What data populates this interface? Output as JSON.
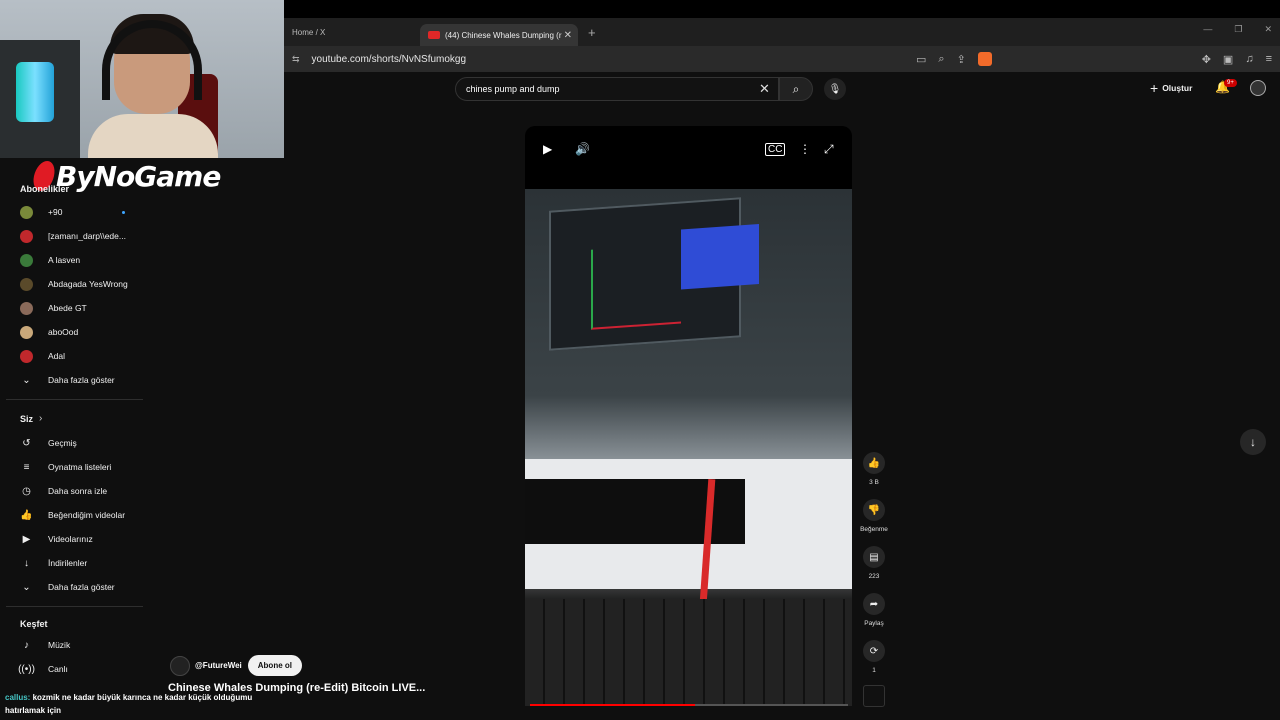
{
  "browser": {
    "tabs": [
      {
        "label": "Home / X"
      },
      {
        "label": "(44) Chinese Whales Dumping (r"
      }
    ],
    "new_tab": "+",
    "url": "youtube.com/shorts/NvNSfumokgg"
  },
  "stream_overlay": {
    "logo_text": "ByNoGame"
  },
  "header": {
    "search_value": "chines pump and dump",
    "create_label": "Oluştur",
    "notification_count": "9+"
  },
  "sidebar": {
    "subscriptions_title": "Abonelikler",
    "subscriptions": [
      {
        "label": "+90",
        "color": "#7a8a3a"
      },
      {
        "label": "[zamanı_darp\\\\ede...",
        "color": "#c0282c"
      },
      {
        "label": "A lasven",
        "color": "#3a7a3a"
      },
      {
        "label": "Abdagada YesWrong",
        "color": "#5a4a2a"
      },
      {
        "label": "Abede GT",
        "color": "#8a6a5a"
      },
      {
        "label": "aboOod",
        "color": "#c9a87a"
      },
      {
        "label": "Adal",
        "color": "#c0282c"
      }
    ],
    "show_more_1": "Daha fazla göster",
    "you_title": "Siz",
    "you_items": [
      {
        "label": "Geçmiş",
        "icon": "history-icon"
      },
      {
        "label": "Oynatma listeleri",
        "icon": "playlist-icon"
      },
      {
        "label": "Daha sonra izle",
        "icon": "clock-icon"
      },
      {
        "label": "Beğendiğim videolar",
        "icon": "like-icon"
      },
      {
        "label": "Videolarınız",
        "icon": "video-icon"
      },
      {
        "label": "İndirilenler",
        "icon": "download-icon"
      }
    ],
    "show_more_2": "Daha fazla göster",
    "explore_title": "Keşfet",
    "explore_items": [
      {
        "label": "Müzik",
        "icon": "music-icon"
      },
      {
        "label": "Canlı",
        "icon": "live-icon"
      }
    ]
  },
  "short": {
    "channel_handle": "@FutureWei",
    "subscribe_label": "Abone ol",
    "title": "Chinese Whales Dumping (re-Edit) Bitcoin LIVE...",
    "progress": 0.52
  },
  "actions": {
    "likes": "3 B",
    "dislike_label": "Beğenme",
    "comments": "223",
    "share_label": "Paylaş",
    "remix_count": "1"
  },
  "chat": {
    "user": "callus:",
    "message": "kozmik ne kadar büyük karınca ne kadar küçük olduğumu hatırlamak için"
  }
}
